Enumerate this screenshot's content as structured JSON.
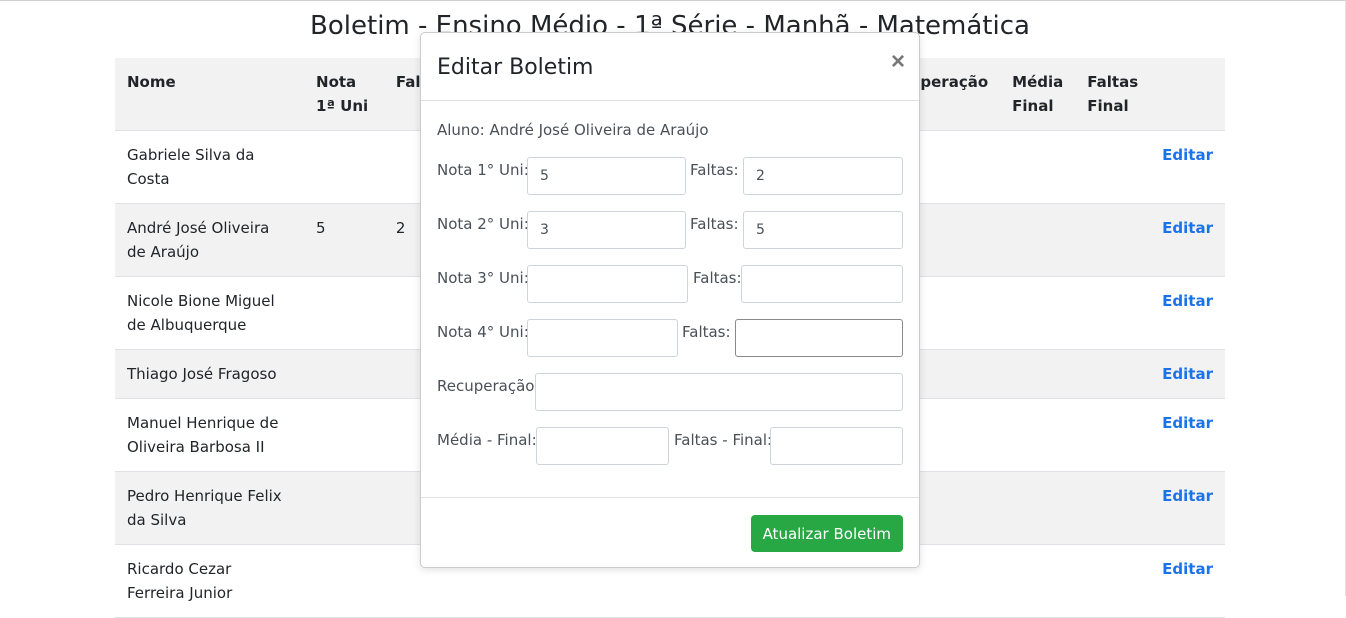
{
  "page": {
    "title": "Boletim - Ensino Médio - 1ª Série - Manhã - Matemática"
  },
  "table": {
    "headers": {
      "nome": "Nome",
      "nota1": "Nota 1ª Uni",
      "faltas1": "Fal",
      "recuperacao": "ecuperação",
      "media_final": "Média Final",
      "faltas_final": "Faltas Final"
    },
    "rows": [
      {
        "name": "Gabriele Silva da Costa",
        "nota1": "",
        "faltas1": "",
        "action": "Editar"
      },
      {
        "name": "André José Oliveira de Araújo",
        "nota1": "5",
        "faltas1": "2",
        "action": "Editar"
      },
      {
        "name": "Nicole Bione Miguel de Albuquerque",
        "nota1": "",
        "faltas1": "",
        "action": "Editar"
      },
      {
        "name": "Thiago José Fragoso",
        "nota1": "",
        "faltas1": "",
        "action": "Editar"
      },
      {
        "name": "Manuel Henrique de Oliveira Barbosa II",
        "nota1": "",
        "faltas1": "",
        "action": "Editar"
      },
      {
        "name": "Pedro Henrique Felix da Silva",
        "nota1": "",
        "faltas1": "",
        "action": "Editar"
      },
      {
        "name": "Ricardo Cezar Ferreira Junior",
        "nota1": "",
        "faltas1": "",
        "action": "Editar"
      }
    ]
  },
  "modal": {
    "title": "Editar Boletim",
    "close": "×",
    "aluno": "Aluno: André José Oliveira de Araújo",
    "labels": {
      "nota1": "Nota 1° Uni:",
      "nota2": "Nota 2° Uni:",
      "nota3": "Nota 3° Uni:",
      "nota4": "Nota 4° Uni:",
      "faltas": "Faltas:",
      "recuperacao": "Recuperação :",
      "media_final": "Média - Final:",
      "faltas_final": "Faltas - Final:"
    },
    "values": {
      "nota1": "5",
      "faltas1": "2",
      "nota2": "3",
      "faltas2": "5",
      "nota3": "",
      "faltas3": "",
      "nota4": "",
      "faltas4": "",
      "recuperacao": "",
      "media_final": "",
      "faltas_final": ""
    },
    "submit": "Atualizar Boletim"
  }
}
